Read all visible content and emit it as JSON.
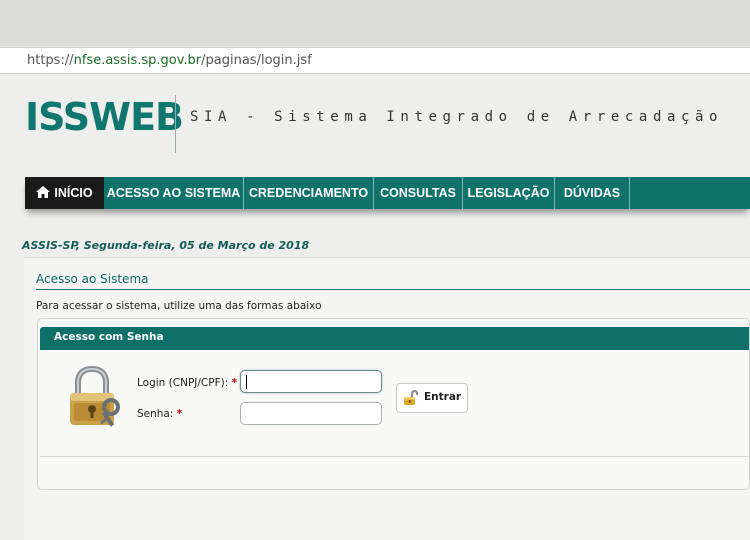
{
  "browser": {
    "url_scheme": "https://",
    "url_host": "nfse.assis.sp.gov.br",
    "url_path": "/paginas/login.jsf"
  },
  "header": {
    "logo": "ISSWEB",
    "tagline": "SIA - Sistema Integrado de Arrecadação"
  },
  "nav": {
    "items": [
      {
        "label": "INÍCIO",
        "icon": "home-icon",
        "active": true
      },
      {
        "label": "ACESSO AO SISTEMA"
      },
      {
        "label": "CREDENCIAMENTO"
      },
      {
        "label": "CONSULTAS"
      },
      {
        "label": "LEGISLAÇÃO"
      },
      {
        "label": "DÚVIDAS"
      }
    ]
  },
  "date_line": "ASSIS-SP, Segunda-feira, 05 de Março de 2018",
  "section": {
    "title": "Acesso ao Sistema",
    "instruction": "Para acessar o sistema, utilize uma das formas abaixo"
  },
  "login_panel": {
    "title": "Acesso com Senha",
    "login_label": "Login (CNPJ/CPF):",
    "password_label": "Senha:",
    "required_mark": "*",
    "login_value": "",
    "password_value": "",
    "submit_label": "Entrar"
  },
  "colors": {
    "brand": "#0f7670",
    "nav_bg": "#0f736c",
    "nav_active": "#1a1a1a",
    "required": "#cc0000"
  }
}
